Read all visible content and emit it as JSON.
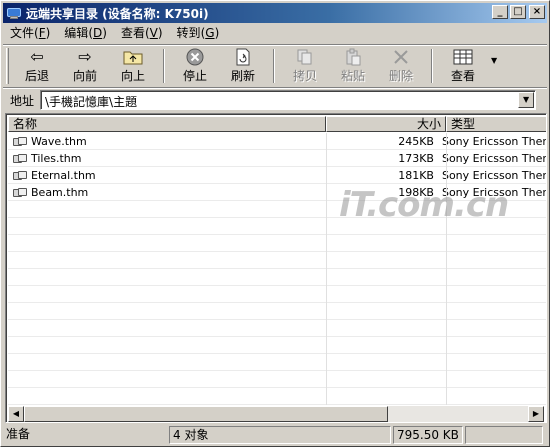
{
  "window": {
    "title": "远端共享目录 (设备名称: K750i)",
    "title_gradient_start": "#0a246a",
    "title_gradient_end": "#a6caf0",
    "buttons": {
      "minimize": "_",
      "maximize": "□",
      "close": "×"
    }
  },
  "menu": [
    {
      "label": "文件",
      "key": "F"
    },
    {
      "label": "编辑",
      "key": "D"
    },
    {
      "label": "查看",
      "key": "V"
    },
    {
      "label": "转到",
      "key": "G"
    }
  ],
  "toolbar": {
    "back": {
      "label": "后退",
      "icon": "arrow-left-icon",
      "glyph": "⇦"
    },
    "forward": {
      "label": "向前",
      "icon": "arrow-right-icon",
      "glyph": "⇨"
    },
    "up": {
      "label": "向上",
      "icon": "folder-up-icon",
      "glyph": "📁"
    },
    "stop": {
      "label": "停止",
      "icon": "stop-icon",
      "glyph": "✕"
    },
    "refresh": {
      "label": "刷新",
      "icon": "refresh-icon",
      "glyph": "⟳"
    },
    "copy": {
      "label": "拷贝",
      "icon": "copy-icon",
      "glyph": "⎘",
      "disabled": true
    },
    "paste": {
      "label": "粘贴",
      "icon": "paste-icon",
      "glyph": "📋",
      "disabled": true
    },
    "delete": {
      "label": "删除",
      "icon": "delete-icon",
      "glyph": "✕",
      "disabled": true
    },
    "view": {
      "label": "查看",
      "icon": "view-grid-icon",
      "glyph": "▦"
    }
  },
  "address": {
    "label": "地址",
    "value": "\\手機記憶庫\\主題"
  },
  "list": {
    "columns": {
      "name": "名称",
      "size": "大小",
      "type": "类型"
    },
    "rows": [
      {
        "name": "Wave.thm",
        "size": "245KB",
        "type": "Sony Ericsson Theme"
      },
      {
        "name": "Tiles.thm",
        "size": "173KB",
        "type": "Sony Ericsson Theme"
      },
      {
        "name": "Eternal.thm",
        "size": "181KB",
        "type": "Sony Ericsson Theme"
      },
      {
        "name": "Beam.thm",
        "size": "198KB",
        "type": "Sony Ericsson Theme"
      }
    ]
  },
  "watermark": "iT.com.cn",
  "status": {
    "ready": "准备",
    "objects": "4 对象",
    "size": "795.50 KB"
  }
}
